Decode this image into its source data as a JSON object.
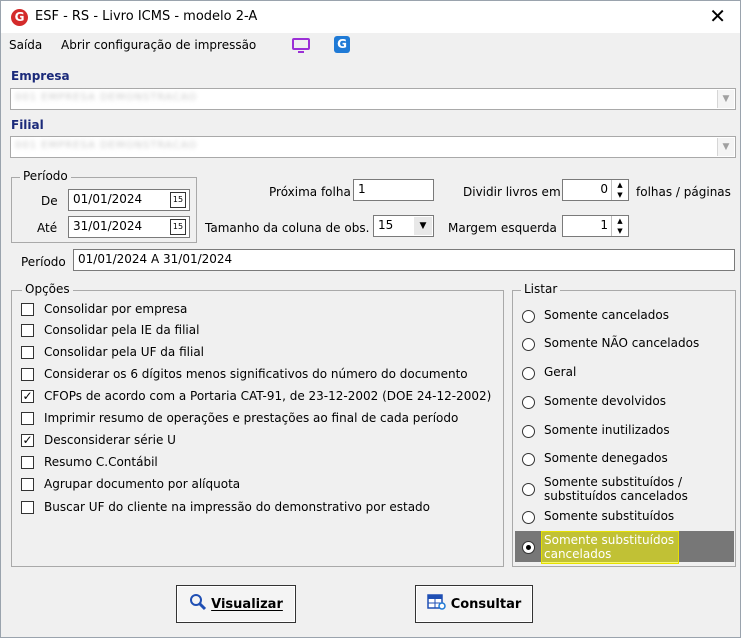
{
  "window": {
    "title": "ESF - RS - Livro ICMS - modelo 2-A",
    "app_icon_glyph": "G",
    "close_glyph": "✕"
  },
  "menu": {
    "exit": "Saída",
    "open_print_config": "Abrir configuração de impressão",
    "g_icon_glyph": "G"
  },
  "empresa": {
    "label": "Empresa",
    "value": "001 EMPRESA DEMONSTRACAO"
  },
  "filial": {
    "label": "Filial",
    "value": "001 EMPRESA DEMONSTRACAO"
  },
  "periodo_group": {
    "title": "Período",
    "de_label": "De",
    "de_value": "01/01/2024",
    "ate_label": "Até",
    "ate_value": "31/01/2024",
    "calendar_glyph": "15"
  },
  "proxima_folha": {
    "label": "Próxima folha",
    "value": "1"
  },
  "tamanho_coluna": {
    "label": "Tamanho da coluna de obs.",
    "value": "15"
  },
  "dividir_livros": {
    "label": "Dividir livros em",
    "value": "0",
    "suffix": "folhas / páginas"
  },
  "margem_esquerda": {
    "label": "Margem esquerda",
    "value": "1"
  },
  "periodo_field": {
    "label": "Período",
    "value": "01/01/2024 A 31/01/2024"
  },
  "opcoes": {
    "title": "Opções",
    "items": [
      {
        "label": "Consolidar por empresa",
        "checked": false
      },
      {
        "label": "Consolidar pela IE da filial",
        "checked": false
      },
      {
        "label": "Consolidar pela UF da filial",
        "checked": false
      },
      {
        "label": "Considerar os 6 dígitos menos significativos do número do documento",
        "checked": false
      },
      {
        "label": "CFOPs de acordo com a Portaria CAT-91, de 23-12-2002 (DOE 24-12-2002)",
        "checked": true
      },
      {
        "label": "Imprimir resumo de operações e prestações ao final de cada período",
        "checked": false
      },
      {
        "label": "Desconsiderar série U",
        "checked": true
      },
      {
        "label": "Resumo C.Contábil",
        "checked": false
      },
      {
        "label": "Agrupar documento por alíquota",
        "checked": false
      },
      {
        "label": "Buscar UF do cliente na impressão do demonstrativo por estado",
        "checked": false
      }
    ]
  },
  "listar": {
    "title": "Listar",
    "items": [
      {
        "label": "Somente cancelados"
      },
      {
        "label": "Somente NÃO cancelados"
      },
      {
        "label": "Geral"
      },
      {
        "label": "Somente devolvidos"
      },
      {
        "label": "Somente inutilizados"
      },
      {
        "label": "Somente denegados"
      },
      {
        "label": "Somente substituídos /",
        "label2": "substituídos cancelados"
      },
      {
        "label": "Somente substituídos"
      },
      {
        "label": "Somente substituídos",
        "label2": "cancelados"
      }
    ],
    "selected_index": 8
  },
  "buttons": {
    "visualizar_label": "Visualizar",
    "consultar_label": "Consultar"
  },
  "colors": {
    "section_label": "#1b2a7a",
    "app_red": "#d42b2b",
    "accent_blue": "#1f7ad6",
    "monitor_purple": "#9b30d6"
  }
}
